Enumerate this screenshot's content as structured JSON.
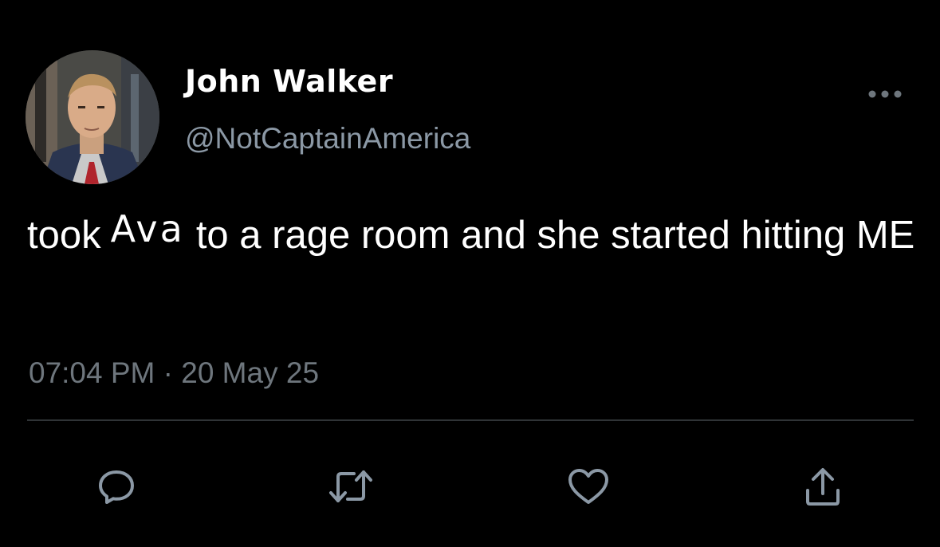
{
  "tweet": {
    "author": {
      "display_name": "John Walker",
      "handle": "@NotCaptainAmerica"
    },
    "text": {
      "part1": "took",
      "highlight": "Ava",
      "part2": "to a rage room and she started hitting ME"
    },
    "timestamp": "07:04 PM · 20 May 25"
  },
  "actions": {
    "reply_icon": "reply-icon",
    "retweet_icon": "retweet-icon",
    "like_icon": "heart-icon",
    "share_icon": "share-icon"
  },
  "colors": {
    "background": "#000000",
    "text_primary": "#ffffff",
    "text_secondary": "#8b98a5",
    "icon": "#8b98a5",
    "divider": "#2f3336"
  }
}
